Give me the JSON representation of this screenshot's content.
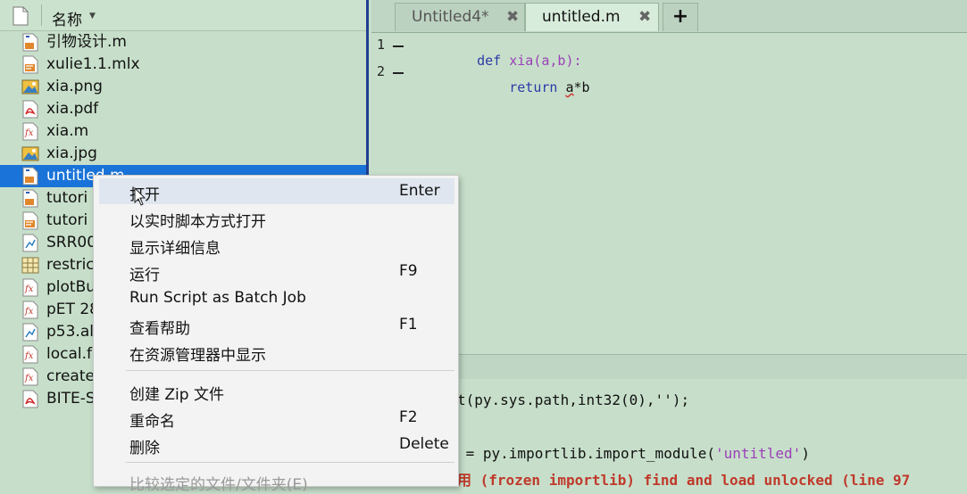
{
  "file_browser": {
    "column_header": "名称",
    "files": [
      {
        "name": "引物设计.m",
        "icon": "matlab-script-icon"
      },
      {
        "name": "xulie1.1.mlx",
        "icon": "live-script-icon"
      },
      {
        "name": "xia.png",
        "icon": "image-file-icon"
      },
      {
        "name": "xia.pdf",
        "icon": "pdf-file-icon"
      },
      {
        "name": "xia.m",
        "icon": "matlab-function-icon"
      },
      {
        "name": "xia.jpg",
        "icon": "image-file-icon"
      },
      {
        "name": "untitled.m",
        "icon": "matlab-script-icon",
        "selected": true
      },
      {
        "name": "tutori",
        "icon": "matlab-script-icon"
      },
      {
        "name": "tutori",
        "icon": "live-script-icon"
      },
      {
        "name": "SRR00",
        "icon": "data-file-icon"
      },
      {
        "name": "restric",
        "icon": "table-file-icon"
      },
      {
        "name": "plotBu",
        "icon": "matlab-function-icon"
      },
      {
        "name": "pET 28",
        "icon": "matlab-function-icon"
      },
      {
        "name": "p53.al",
        "icon": "data-file-icon"
      },
      {
        "name": "local.f",
        "icon": "matlab-function-icon"
      },
      {
        "name": "create",
        "icon": "matlab-function-icon"
      },
      {
        "name": "BITE-S",
        "icon": "pdf-file-icon"
      }
    ]
  },
  "editor": {
    "tabs": [
      {
        "label": "Untitled4*",
        "active": false
      },
      {
        "label": "untitled.m",
        "active": true
      }
    ],
    "add_tab_label": "+",
    "lines": [
      {
        "number": "1",
        "parts": [
          {
            "t": "def ",
            "c": "kw"
          },
          {
            "t": "xia(a,b):",
            "c": "fn"
          }
        ]
      },
      {
        "number": "2",
        "parts": [
          {
            "t": "    return ",
            "c": "kw"
          },
          {
            "t": "a",
            "c": "und"
          },
          {
            "t": "*b",
            "c": ""
          }
        ]
      }
    ]
  },
  "command_window": {
    "line1": "t(py.sys.path,int32(0),'');",
    "line2_prefix": " = py.importlib.import_module(",
    "line2_string": "'untitled'",
    "line2_suffix": ")",
    "line3": "用 (frozen importlib) find and load unlocked (line 97"
  },
  "context_menu": {
    "items": [
      {
        "label": "打开",
        "shortcut": "Enter"
      },
      {
        "label": "以实时脚本方式打开",
        "shortcut": ""
      },
      {
        "label": "显示详细信息",
        "shortcut": ""
      },
      {
        "label": "运行",
        "shortcut": "F9"
      },
      {
        "label": "Run Script as Batch Job",
        "shortcut": ""
      },
      {
        "label": "查看帮助",
        "shortcut": "F1"
      },
      {
        "label": "在资源管理器中显示",
        "shortcut": ""
      },
      {
        "label": "创建 Zip 文件",
        "shortcut": ""
      },
      {
        "label": "重命名",
        "shortcut": "F2"
      },
      {
        "label": "删除",
        "shortcut": "Delete"
      },
      {
        "label": "比较选定的文件/文件夹(E)",
        "shortcut": ""
      }
    ]
  },
  "colors": {
    "background": "#c7dfca",
    "selection": "#1a73d8",
    "keyword": "#2b3aa8",
    "string": "#9b3fb8"
  }
}
